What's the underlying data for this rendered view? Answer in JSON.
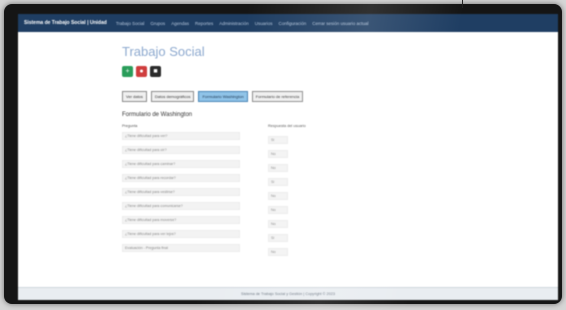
{
  "app": {
    "brand": "Sistema de Trabajo Social | Unidad",
    "nav": [
      "Trabajo Social",
      "Grupos",
      "Agendas",
      "Reportes",
      "Administración",
      "Usuarios",
      "Configuración",
      "Cerrar sesión usuario actual"
    ]
  },
  "page": {
    "title": "Trabajo Social",
    "subheading": "Formulario de Washington"
  },
  "icons": [
    {
      "name": "add-icon",
      "color": "#2a9d5a",
      "glyph": "+"
    },
    {
      "name": "delete-icon",
      "color": "#cf3d3d",
      "glyph": "●"
    },
    {
      "name": "print-icon",
      "color": "#2a2a2a",
      "glyph": "■"
    }
  ],
  "tabs": [
    {
      "label": "Ver datos",
      "active": false
    },
    {
      "label": "Datos demográficos",
      "active": false
    },
    {
      "label": "Formulario Washington",
      "active": true
    },
    {
      "label": "Formulario de referencia",
      "active": false
    }
  ],
  "form": {
    "left_header": "Pregunta",
    "right_header": "Respuesta del usuario",
    "questions": [
      "¿Tiene dificultad para ver?",
      "¿Tiene dificultad para oír?",
      "¿Tiene dificultad para caminar?",
      "¿Tiene dificultad para recordar?",
      "¿Tiene dificultad para vestirse?",
      "¿Tiene dificultad para comunicarse?",
      "¿Tiene dificultad para moverse?",
      "¿Tiene dificultad para ver lejos?",
      "Evaluación - Pregunta final"
    ],
    "answers": [
      "Sí",
      "No",
      "No",
      "Sí",
      "No",
      "No",
      "No",
      "Sí",
      "No"
    ]
  },
  "footer": "Sistema de Trabajo Social y Gestión | Copyright © 2023"
}
